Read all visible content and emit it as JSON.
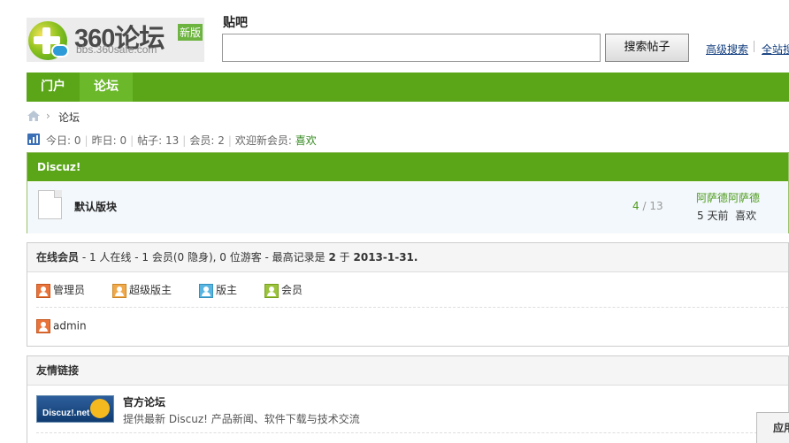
{
  "logo": {
    "brand": "360论坛",
    "badge": "新版",
    "url": "bbs.360safe.com"
  },
  "search": {
    "label": "贴吧",
    "value": "",
    "button": "搜索帖子",
    "advanced": "高级搜索",
    "full": "全站搜"
  },
  "nav": {
    "items": [
      {
        "label": "门户"
      },
      {
        "label": "论坛"
      }
    ]
  },
  "breadcrumb": {
    "current": "论坛"
  },
  "stats": {
    "today_label": "今日:",
    "today": "0",
    "yesterday_label": "昨日:",
    "yesterday": "0",
    "posts_label": "帖子:",
    "posts": "13",
    "members_label": "会员:",
    "members": "2",
    "welcome_label": "欢迎新会员:",
    "newest": "喜欢"
  },
  "forum": {
    "category": "Discuz!",
    "name": "默认版块",
    "threads": "4",
    "slash": "/",
    "posts": "13",
    "last_title": "阿萨德阿萨德",
    "last_time": "5 天前",
    "last_user": "喜欢"
  },
  "online": {
    "title": "在线会员",
    "summary": " - 1 人在线  - 1 会员(0 隐身), 0 位游客  - 最高记录是 ",
    "record": "2",
    "record_on": " 于 ",
    "record_date": "2013-1-31.",
    "legend": [
      {
        "label": "管理员",
        "color": "#e8743b"
      },
      {
        "label": "超级版主",
        "color": "#f0a94a"
      },
      {
        "label": "版主",
        "color": "#58b4e0"
      },
      {
        "label": "会员",
        "color": "#9cc33c"
      }
    ],
    "user": "admin"
  },
  "links": {
    "title": "友情链接",
    "logo_text": "Discuz!.net",
    "site": "官方论坛",
    "desc": "提供最新 Discuz! 产品新闻、软件下载与技术交流"
  },
  "float_button": "应用"
}
